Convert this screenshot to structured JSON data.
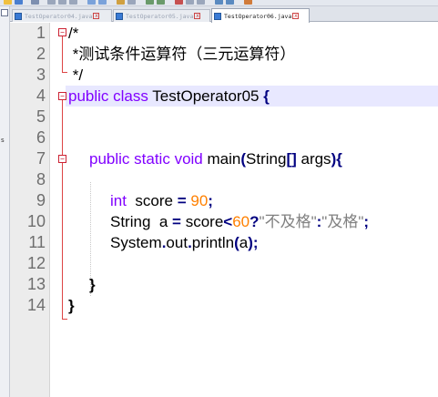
{
  "tabs": [
    {
      "label": "TestOperator04.java",
      "active": false
    },
    {
      "label": "TestOperator05.java",
      "active": false
    },
    {
      "label": "TestOperator06.java",
      "active": true
    }
  ],
  "side_panel": {
    "letter": "s"
  },
  "code": {
    "line_numbers": [
      "1",
      "2",
      "3",
      "4",
      "5",
      "6",
      "7",
      "8",
      "9",
      "10",
      "11",
      "12",
      "13",
      "14"
    ],
    "line1": {
      "text": "/*"
    },
    "line2": {
      "text": " *测试条件运算符（三元运算符）"
    },
    "line3": {
      "text": " */"
    },
    "line4": {
      "kw1": "public",
      "kw2": "class",
      "name": " TestOperator05 ",
      "brace": "{"
    },
    "line7": {
      "kw1": "public",
      "kw2": "static",
      "kw3": "void",
      "name": " main",
      "p1": "(",
      "type": "String",
      "br": "[]",
      "arg": " args",
      "p2": ")",
      "brace": "{"
    },
    "line9": {
      "type": "int",
      "var": "  score ",
      "eq": "=",
      "num": " 90",
      "semi": ";"
    },
    "line10": {
      "type": "String",
      "var": "  a ",
      "eq": "=",
      "var2": " score",
      "lt": "<",
      "num": "60",
      "q": "?",
      "s1": "\"不及格\"",
      "colon": ":",
      "s2": "\"及格\"",
      "semi": ";"
    },
    "line11": {
      "obj": "System",
      "dot1": ".",
      "field": "out",
      "dot2": ".",
      "method": "println",
      "p1": "(",
      "arg": "a",
      "p2": ")",
      "semi": ";"
    },
    "line13": {
      "brace": "}"
    },
    "line14": {
      "brace": "}"
    }
  },
  "colors": {
    "comment": "#008000",
    "keyword": "#8000ff",
    "operator": "#000080",
    "number": "#ff8000",
    "string": "#808080",
    "current_line": "#e8e8ff"
  }
}
